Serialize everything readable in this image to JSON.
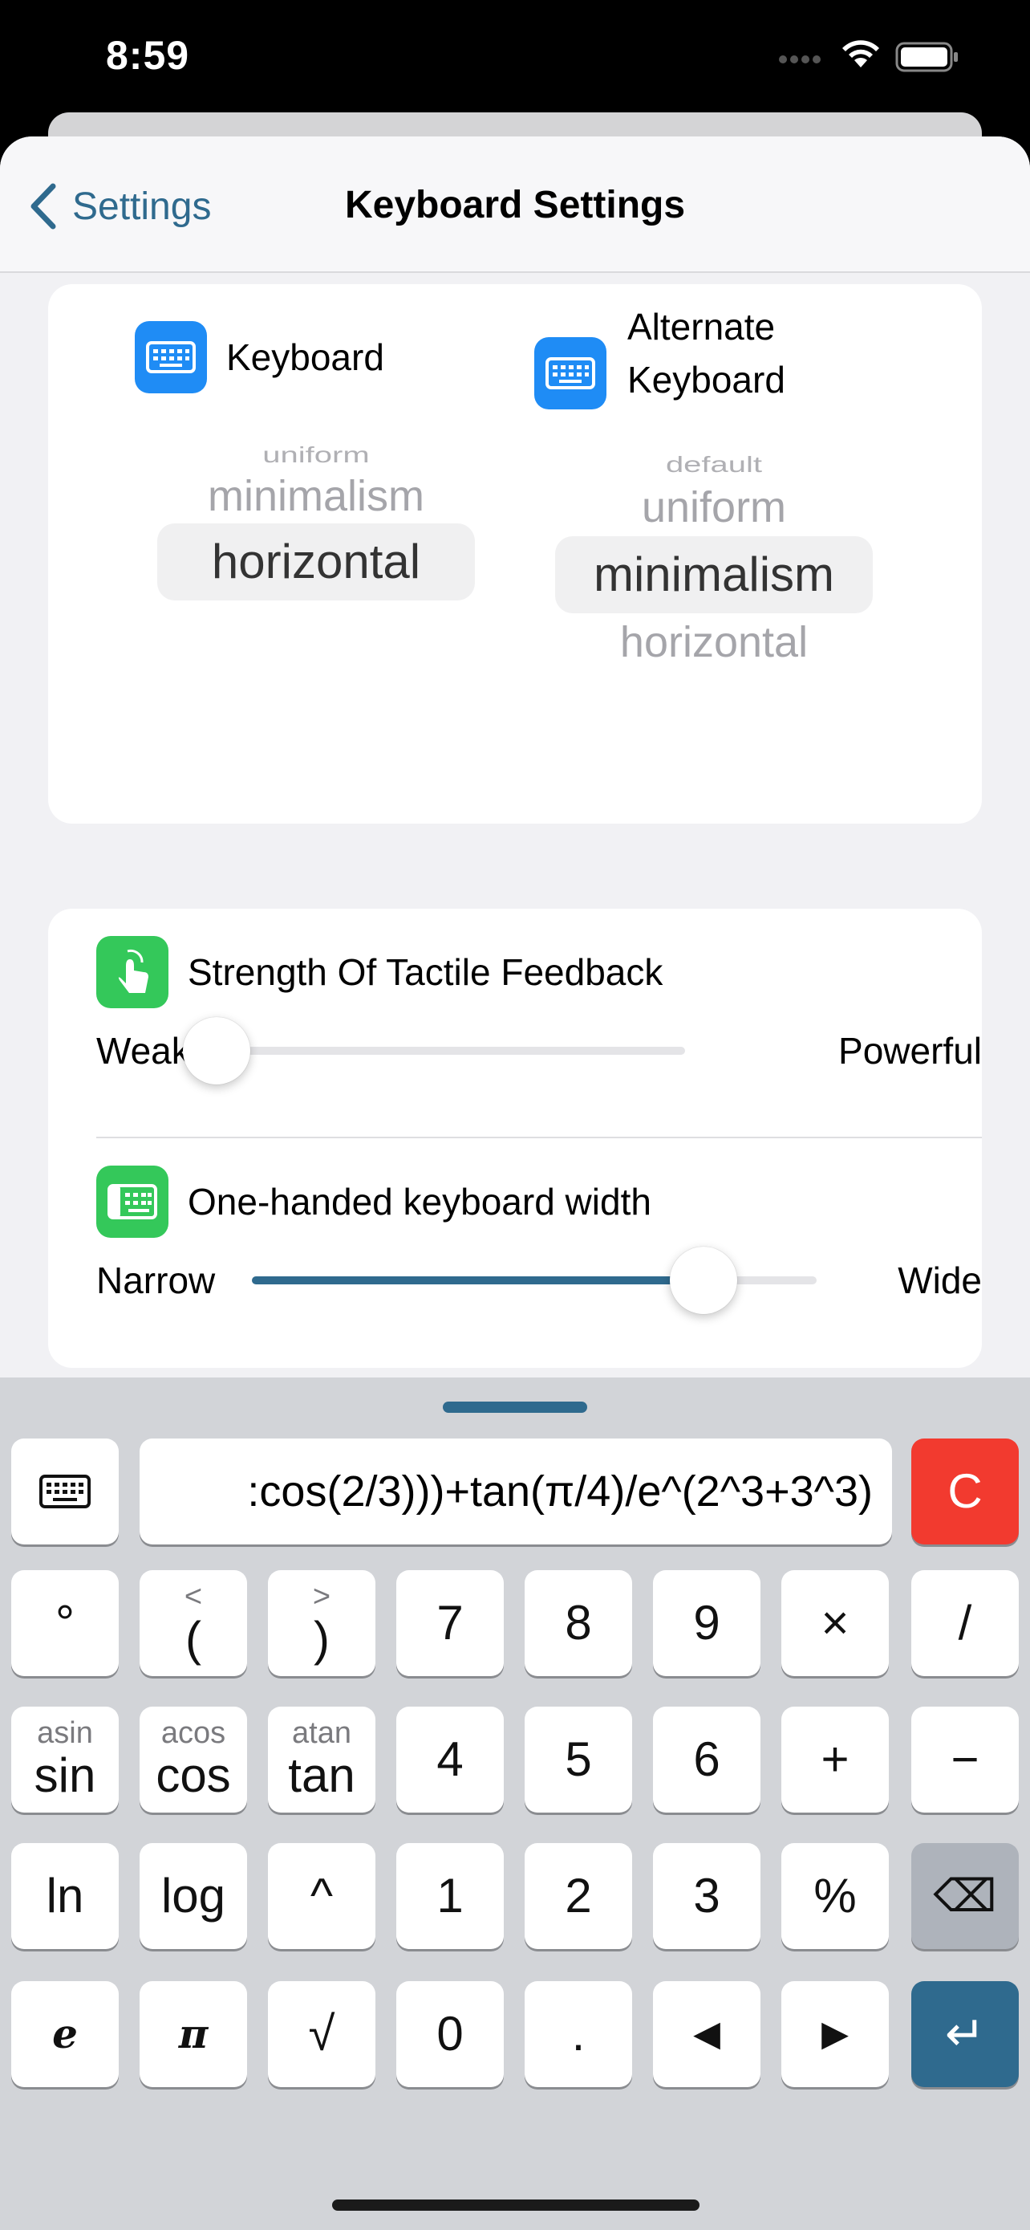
{
  "status_bar": {
    "time": "8:59"
  },
  "nav": {
    "back_label": "Settings",
    "title": "Keyboard Settings"
  },
  "keyboard_picker": {
    "label": "Keyboard",
    "options_visible": [
      "uniform",
      "minimalism",
      "horizontal"
    ],
    "selected": "horizontal"
  },
  "alternate_picker": {
    "label_line1": "Alternate",
    "label_line2": "Keyboard",
    "options_visible": [
      "default",
      "uniform",
      "minimalism",
      "horizontal"
    ],
    "selected": "minimalism"
  },
  "tactile": {
    "label": "Strength Of Tactile Feedback",
    "min_label": "Weak",
    "max_label": "Powerful",
    "value_fraction": 0.0
  },
  "width": {
    "label": "One-handed keyboard width",
    "min_label": "Narrow",
    "max_label": "Wide",
    "value_fraction": 0.8
  },
  "calculator": {
    "expression": ":cos(2/3)))+tan(π/4)/e^(2^3+3^3)",
    "clear_label": "C",
    "rows": [
      [
        {
          "main": "°"
        },
        {
          "sub": "<",
          "main": "("
        },
        {
          "sub": ">",
          "main": ")"
        },
        {
          "main": "7"
        },
        {
          "main": "8"
        },
        {
          "main": "9"
        },
        {
          "main": "×"
        },
        {
          "main": "/"
        }
      ],
      [
        {
          "sub": "asin",
          "main": "sin"
        },
        {
          "sub": "acos",
          "main": "cos"
        },
        {
          "sub": "atan",
          "main": "tan"
        },
        {
          "main": "4"
        },
        {
          "main": "5"
        },
        {
          "main": "6"
        },
        {
          "main": "+"
        },
        {
          "main": "−"
        }
      ],
      [
        {
          "main": "ln"
        },
        {
          "main": "log"
        },
        {
          "main": "^"
        },
        {
          "main": "1"
        },
        {
          "main": "2"
        },
        {
          "main": "3"
        },
        {
          "main": "%"
        },
        {
          "main": "⌫"
        }
      ],
      [
        {
          "main": "e"
        },
        {
          "main": "π"
        },
        {
          "main": "√"
        },
        {
          "main": "0"
        },
        {
          "main": "."
        },
        {
          "main": "◀"
        },
        {
          "main": "▶"
        },
        {
          "main": "↵"
        }
      ]
    ]
  },
  "colors": {
    "accent": "#2f6a8e",
    "icon_blue": "#1f8cf5",
    "icon_green": "#34c85a",
    "clear_red": "#f23a2f"
  }
}
